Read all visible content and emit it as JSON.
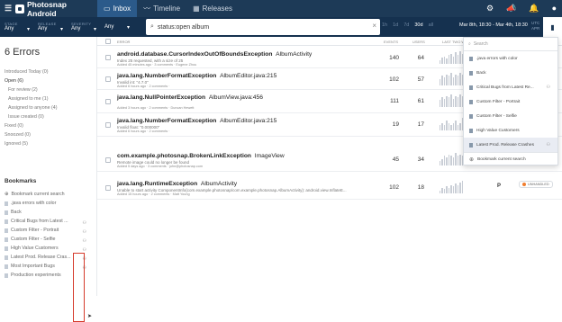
{
  "app": {
    "title": "Photosnap Android"
  },
  "nav": {
    "tabs": [
      {
        "label": "Inbox"
      },
      {
        "label": "Timeline"
      },
      {
        "label": "Releases"
      }
    ]
  },
  "filters": [
    {
      "label": "STAGE",
      "value": "Any"
    },
    {
      "label": "RELEASE",
      "value": "Any"
    },
    {
      "label": "SEVERITY",
      "value": "Any"
    },
    {
      "label": "",
      "value": "Any"
    }
  ],
  "search": {
    "query": "status:open album",
    "clear": "×"
  },
  "time_ranges": [
    "1h",
    "1d",
    "7d",
    "30d",
    "all"
  ],
  "selected_range": "30d",
  "date_range": "Mar 8th, 18:30 - Mar 4th, 18:30",
  "timezone": [
    "UTC",
    "APR"
  ],
  "sidebar": {
    "error_count": "6 Errors",
    "statuses": [
      {
        "label": "Introduced Today (0)",
        "sub": false,
        "active": false
      },
      {
        "label": "Open (6)",
        "sub": false,
        "active": true
      },
      {
        "label": "For review (2)",
        "sub": true,
        "active": false
      },
      {
        "label": "Assigned to me (1)",
        "sub": true,
        "active": false
      },
      {
        "label": "Assigned to anyone (4)",
        "sub": true,
        "active": false
      },
      {
        "label": "Issue created (0)",
        "sub": true,
        "active": false
      },
      {
        "label": "Fixed (0)",
        "sub": false,
        "active": false
      },
      {
        "label": "Snoozed (0)",
        "sub": false,
        "active": false
      },
      {
        "label": "Ignored (5)",
        "sub": false,
        "active": false
      }
    ],
    "bookmarks_heading": "Bookmarks",
    "bookmark_current_search": "Bookmark current search",
    "bookmarks": [
      {
        "label": ".java errors with color",
        "shared": false
      },
      {
        "label": "Back",
        "shared": false
      },
      {
        "label": "Critical Bugs from Latest ...",
        "shared": true
      },
      {
        "label": "Custom Filter - Portrait",
        "shared": true
      },
      {
        "label": "Custom Filter - Selfie",
        "shared": true
      },
      {
        "label": "High Value Customers",
        "shared": true
      },
      {
        "label": "Latest Prod. Release Cras...",
        "shared": true
      },
      {
        "label": "Most Important Bugs",
        "shared": true
      },
      {
        "label": "Production experiments",
        "shared": false
      }
    ]
  },
  "table": {
    "headers": {
      "error": "ERROR",
      "events": "EVENTS",
      "users": "USERS",
      "last_two": "LAST TWO W"
    },
    "rows": [
      {
        "title": "android.database.CursorIndexOutOfBoundsException",
        "context": "AlbumActivity",
        "subtitle": "Index 25 requested, with a size of 25",
        "meta": "Added 45 minutes ago  ·  3 comments  ·  Eugene Zhou",
        "events": "140",
        "users": "64",
        "spark": [
          3,
          5,
          6,
          4,
          7,
          8,
          6,
          9,
          7,
          10,
          8
        ],
        "priority": "",
        "status": ""
      },
      {
        "title": "java.lang.NumberFormatException",
        "context": "AlbumEditor.java:215",
        "subtitle": "Invalid int: \"4.7.0\"",
        "meta": "Added 6 hours ago  ·  2 comments  ·",
        "events": "102",
        "users": "57",
        "spark": [
          4,
          6,
          5,
          7,
          6,
          8,
          5,
          7,
          6,
          8,
          7
        ],
        "priority": "",
        "status": ""
      },
      {
        "title": "java.lang.NullPointerException",
        "context": "AlbumView.java:456",
        "subtitle": "",
        "meta": "Added 3 hours ago  ·  2 comments  ·  Duncan Hewett",
        "events": "111",
        "users": "61",
        "spark": [
          5,
          7,
          6,
          8,
          7,
          9,
          6,
          8,
          7,
          9,
          8
        ],
        "priority": "",
        "status": ""
      },
      {
        "title": "java.lang.NumberFormatException",
        "context": "AlbumEditor.java:215",
        "subtitle": "Invalid float: \"0.000000\"",
        "meta": "Added 6 hours ago  ·  2 comments  ·",
        "events": "19",
        "users": "17",
        "spark": [
          2,
          3,
          2,
          4,
          3,
          2,
          3,
          4,
          2,
          3,
          5
        ],
        "priority": "",
        "status": ""
      },
      {
        "title": "com.example.photosnap.BrokenLinkException",
        "context": "ImageView",
        "subtitle": "Remote image could no longer be found",
        "meta": "Added 5 days ago  ·  3 comments  ·  john@photosnap.com",
        "events": "45",
        "users": "34",
        "spark": [
          3,
          4,
          6,
          5,
          7,
          6,
          5,
          8,
          6,
          7,
          6
        ],
        "priority": "",
        "status": ""
      },
      {
        "title": "java.lang.RuntimeException",
        "context": "AlbumActivity",
        "subtitle": "Unable to start activity ComponentInfo{com.example.photosnap/com.example.photosnap.AlbumActivity}: android.view.InflateE...",
        "meta": "Added 15 hours ago  ·  2 comments  ·  Matt Young",
        "events": "102",
        "users": "18",
        "spark": [
          2,
          4,
          3,
          5,
          4,
          6,
          5,
          7,
          6,
          8,
          9
        ],
        "priority": "P",
        "status": "UNHANDLED"
      }
    ]
  },
  "dropdown": {
    "search_placeholder": "Search",
    "items": [
      {
        "label": ".java errors with color",
        "shared": false
      },
      {
        "label": "Back",
        "shared": false
      },
      {
        "label": "Critical Bugs from Latest Re...",
        "shared": true
      },
      {
        "label": "Custom Filter - Portrait",
        "shared": true
      },
      {
        "label": "Custom Filter - Selfie",
        "shared": true
      },
      {
        "label": "High Value Customers",
        "shared": true
      },
      {
        "label": "Latest Prod. Release Crashes",
        "shared": true
      }
    ],
    "footer": "Bookmark current search"
  },
  "icons": {
    "brand": "bugsnag-logo",
    "inbox": "inbox-icon",
    "timeline": "timeline-icon",
    "releases": "releases-icon",
    "settings": "gear-icon",
    "announce": "megaphone-icon",
    "notifications": "bell-icon",
    "account": "user-icon",
    "bookmark": "bookmark-icon"
  },
  "colors": {
    "topbar": "#1d3a57",
    "filterbar": "#15314f",
    "active_tab": "#2b5a8a",
    "unhandled_dot": "#f07d2e",
    "highlight_box": "#d63b2c"
  }
}
